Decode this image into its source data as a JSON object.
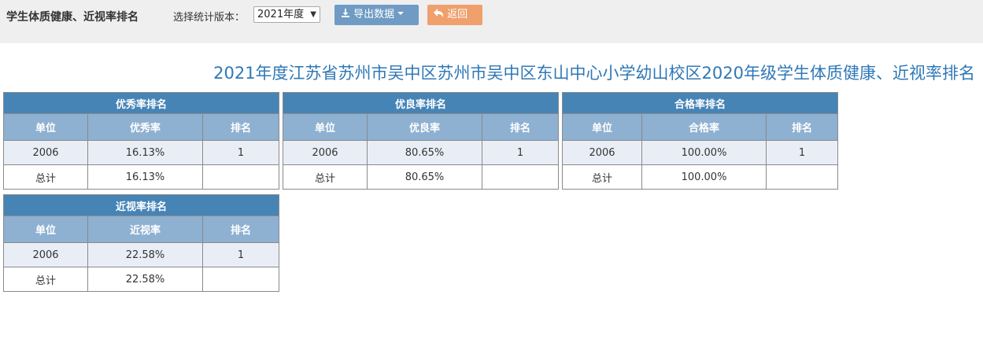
{
  "header": {
    "title": "学生体质健康、近视率排名",
    "version_label": "选择统计版本：",
    "version_selected": "2021年度",
    "export_label": "导出数据",
    "back_label": "返回"
  },
  "report_title": "2021年度江苏省苏州市吴中区苏州市吴中区东山中心小学幼山校区2020年级学生体质健康、近视率排名",
  "tables": [
    {
      "title": "优秀率排名",
      "columns": [
        "单位",
        "优秀率",
        "排名"
      ],
      "rows": [
        [
          "2006",
          "16.13%",
          "1"
        ],
        [
          "总计",
          "16.13%",
          ""
        ]
      ]
    },
    {
      "title": "优良率排名",
      "columns": [
        "单位",
        "优良率",
        "排名"
      ],
      "rows": [
        [
          "2006",
          "80.65%",
          "1"
        ],
        [
          "总计",
          "80.65%",
          ""
        ]
      ]
    },
    {
      "title": "合格率排名",
      "columns": [
        "单位",
        "合格率",
        "排名"
      ],
      "rows": [
        [
          "2006",
          "100.00%",
          "1"
        ],
        [
          "总计",
          "100.00%",
          ""
        ]
      ]
    },
    {
      "title": "近视率排名",
      "columns": [
        "单位",
        "近视率",
        "排名"
      ],
      "rows": [
        [
          "2006",
          "22.58%",
          "1"
        ],
        [
          "总计",
          "22.58%",
          ""
        ]
      ]
    }
  ],
  "icons": {
    "export": "download-icon",
    "export_caret": "caret-down-icon",
    "back": "undo-arrow-icon",
    "select_caret": "triangle-down-icon"
  },
  "colors": {
    "title_blue": "#2f78b7",
    "table_caption": "#4684b6",
    "table_header": "#8eb0d1",
    "row_alt": "#e9eef6",
    "export_button": "#6f9bc4",
    "back_button": "#f0a06c"
  }
}
